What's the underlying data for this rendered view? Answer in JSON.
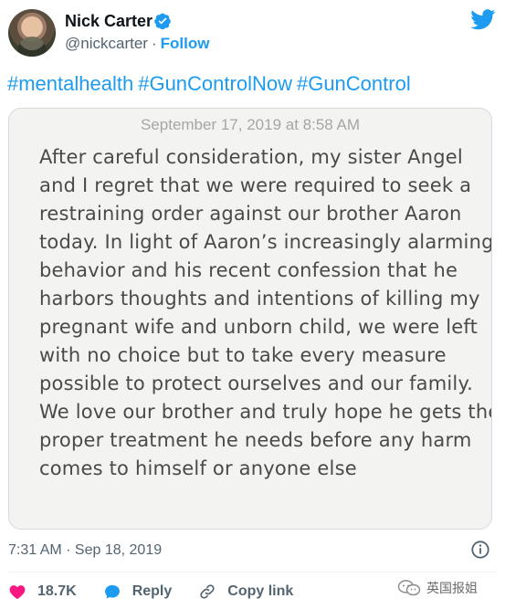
{
  "author": {
    "name": "Nick Carter",
    "handle": "@nickcarter",
    "separator": "·",
    "follow_label": "Follow"
  },
  "hashtags": [
    "#mentalhealth",
    "#GunControlNow",
    "#GunControl"
  ],
  "statement": {
    "date": "September 17, 2019 at 8:58 AM",
    "lines": [
      "After careful consideration, my sister Angel",
      "and I regret that we were required to seek a",
      "restraining order against our brother Aaron",
      "today.  In light of Aaron’s increasingly alarming",
      "behavior and his recent confession that he",
      "harbors thoughts and intentions of killing my",
      "pregnant wife and unborn child, we were left",
      "with no choice but to take every measure",
      "possible to protect ourselves and our family.",
      "We love our brother and truly hope he gets the",
      "proper treatment he needs before any harm",
      "comes to himself or anyone else"
    ]
  },
  "timestamp": "7:31 AM · Sep 18, 2019",
  "actions": {
    "likes": "18.7K",
    "reply_label": "Reply",
    "copy_link_label": "Copy link"
  },
  "watermark": {
    "text": "英国报姐",
    "icon": "wechat-icon"
  },
  "icons": {
    "verified": "verified-badge-icon",
    "twitter": "twitter-bird-icon",
    "info": "info-icon",
    "heart": "heart-icon",
    "reply": "reply-bubble-icon",
    "link": "link-icon"
  },
  "colors": {
    "accent": "#1d9bf0",
    "like": "#f91880",
    "muted": "#536471",
    "statement_bg": "#f3f3f1"
  }
}
